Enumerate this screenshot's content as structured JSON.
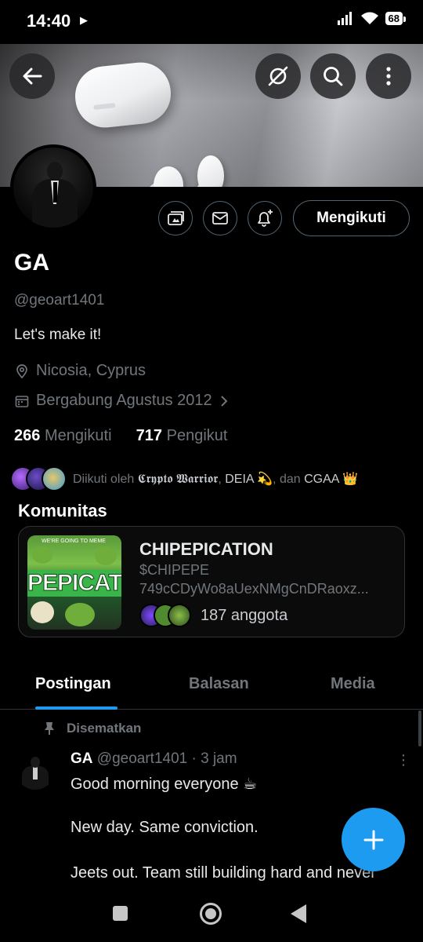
{
  "status_bar": {
    "time": "14:40",
    "battery": "68"
  },
  "header": {
    "back_icon": "arrow-left-icon",
    "mute_icon": "no-connection-icon",
    "search_icon": "search-icon",
    "more_icon": "more-vertical-icon"
  },
  "actions": {
    "follow_label": "Mengikuti",
    "icons": [
      "subscriptions-icon",
      "mail-icon",
      "bell-plus-icon"
    ]
  },
  "profile": {
    "name": "GA",
    "handle": "@geoart1401",
    "bio": "Let's make it!",
    "location": "Nicosia, Cyprus",
    "joined": "Bergabung Agustus 2012",
    "following_count": "266",
    "following_label": "Mengikuti",
    "followers_count": "717",
    "followers_label": "Pengikut",
    "followed_by_prefix": "Diikuti oleh",
    "followed_by_name1": "𝕮𝖗𝖞𝖕𝖙𝖔 𝖂𝖆𝖗𝖗𝖎𝖔𝖗",
    "followed_by_sep": ",",
    "followed_by_name2": "DEIA 💫",
    "followed_by_and": ", dan",
    "followed_by_name3": "CGAA 👑"
  },
  "community": {
    "section_title": "Komunitas",
    "name": "CHIPEPICATION",
    "ticker": "$CHIPEPE",
    "address": "749cCDyWo8aUexNMgCnDRaoxz...",
    "members": "187 anggota",
    "image_text": "PEPICAT",
    "image_top_text": "WE'RE GOING TO MEME"
  },
  "tabs": [
    {
      "label": "Postingan",
      "active": true
    },
    {
      "label": "Balasan",
      "active": false
    },
    {
      "label": "Media",
      "active": false
    }
  ],
  "post": {
    "pinned_label": "Disematkan",
    "author": "GA",
    "handle": "@geoart1401",
    "time": "· 3 jam",
    "lines": [
      "Good morning everyone ☕",
      "New day. Same conviction.",
      "Jeets out. Team still building hard and never"
    ]
  },
  "fab": {
    "icon": "plus-icon"
  },
  "colors": {
    "accent": "#1d9bf0",
    "background": "#000000",
    "muted": "#71767b",
    "border": "#2f3336"
  }
}
